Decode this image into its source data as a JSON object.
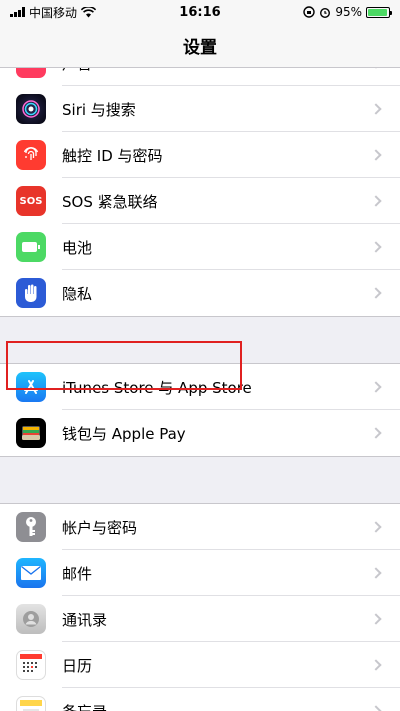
{
  "status": {
    "carrier": "中国移动",
    "time": "16:16",
    "battery": "95%",
    "battery_level": 0.95
  },
  "nav": {
    "title": "设置"
  },
  "groups": [
    {
      "items": [
        {
          "label": "声音",
          "icon": "sound-icon",
          "color": "#ff3b5f"
        },
        {
          "label": "Siri 与搜索",
          "icon": "siri-icon",
          "color": "#1a1a2e"
        },
        {
          "label": "触控 ID 与密码",
          "icon": "fingerprint-icon",
          "color": "#ff3b30"
        },
        {
          "label": "SOS 紧急联络",
          "icon": "sos-icon",
          "color": "#e8342a",
          "icon_text": "SOS"
        },
        {
          "label": "电池",
          "icon": "battery-icon",
          "color": "#4cd964"
        },
        {
          "label": "隐私",
          "icon": "hand-icon",
          "color": "#2c5bd6"
        }
      ]
    },
    {
      "items": [
        {
          "label": "iTunes Store 与 App Store",
          "icon": "app-store-icon",
          "color": "#1e8cf5"
        },
        {
          "label": "钱包与 Apple Pay",
          "icon": "wallet-icon",
          "color": "#000000"
        }
      ]
    },
    {
      "items": [
        {
          "label": "帐户与密码",
          "icon": "key-icon",
          "color": "#8e8e93"
        },
        {
          "label": "邮件",
          "icon": "mail-icon",
          "color": "#1e8cf5"
        },
        {
          "label": "通讯录",
          "icon": "contacts-icon",
          "color": "#c9c9c9"
        },
        {
          "label": "日历",
          "icon": "calendar-icon",
          "color": "#ffffff"
        },
        {
          "label": "备忘录",
          "icon": "notes-icon",
          "color": "#ffd54a"
        }
      ]
    }
  ]
}
